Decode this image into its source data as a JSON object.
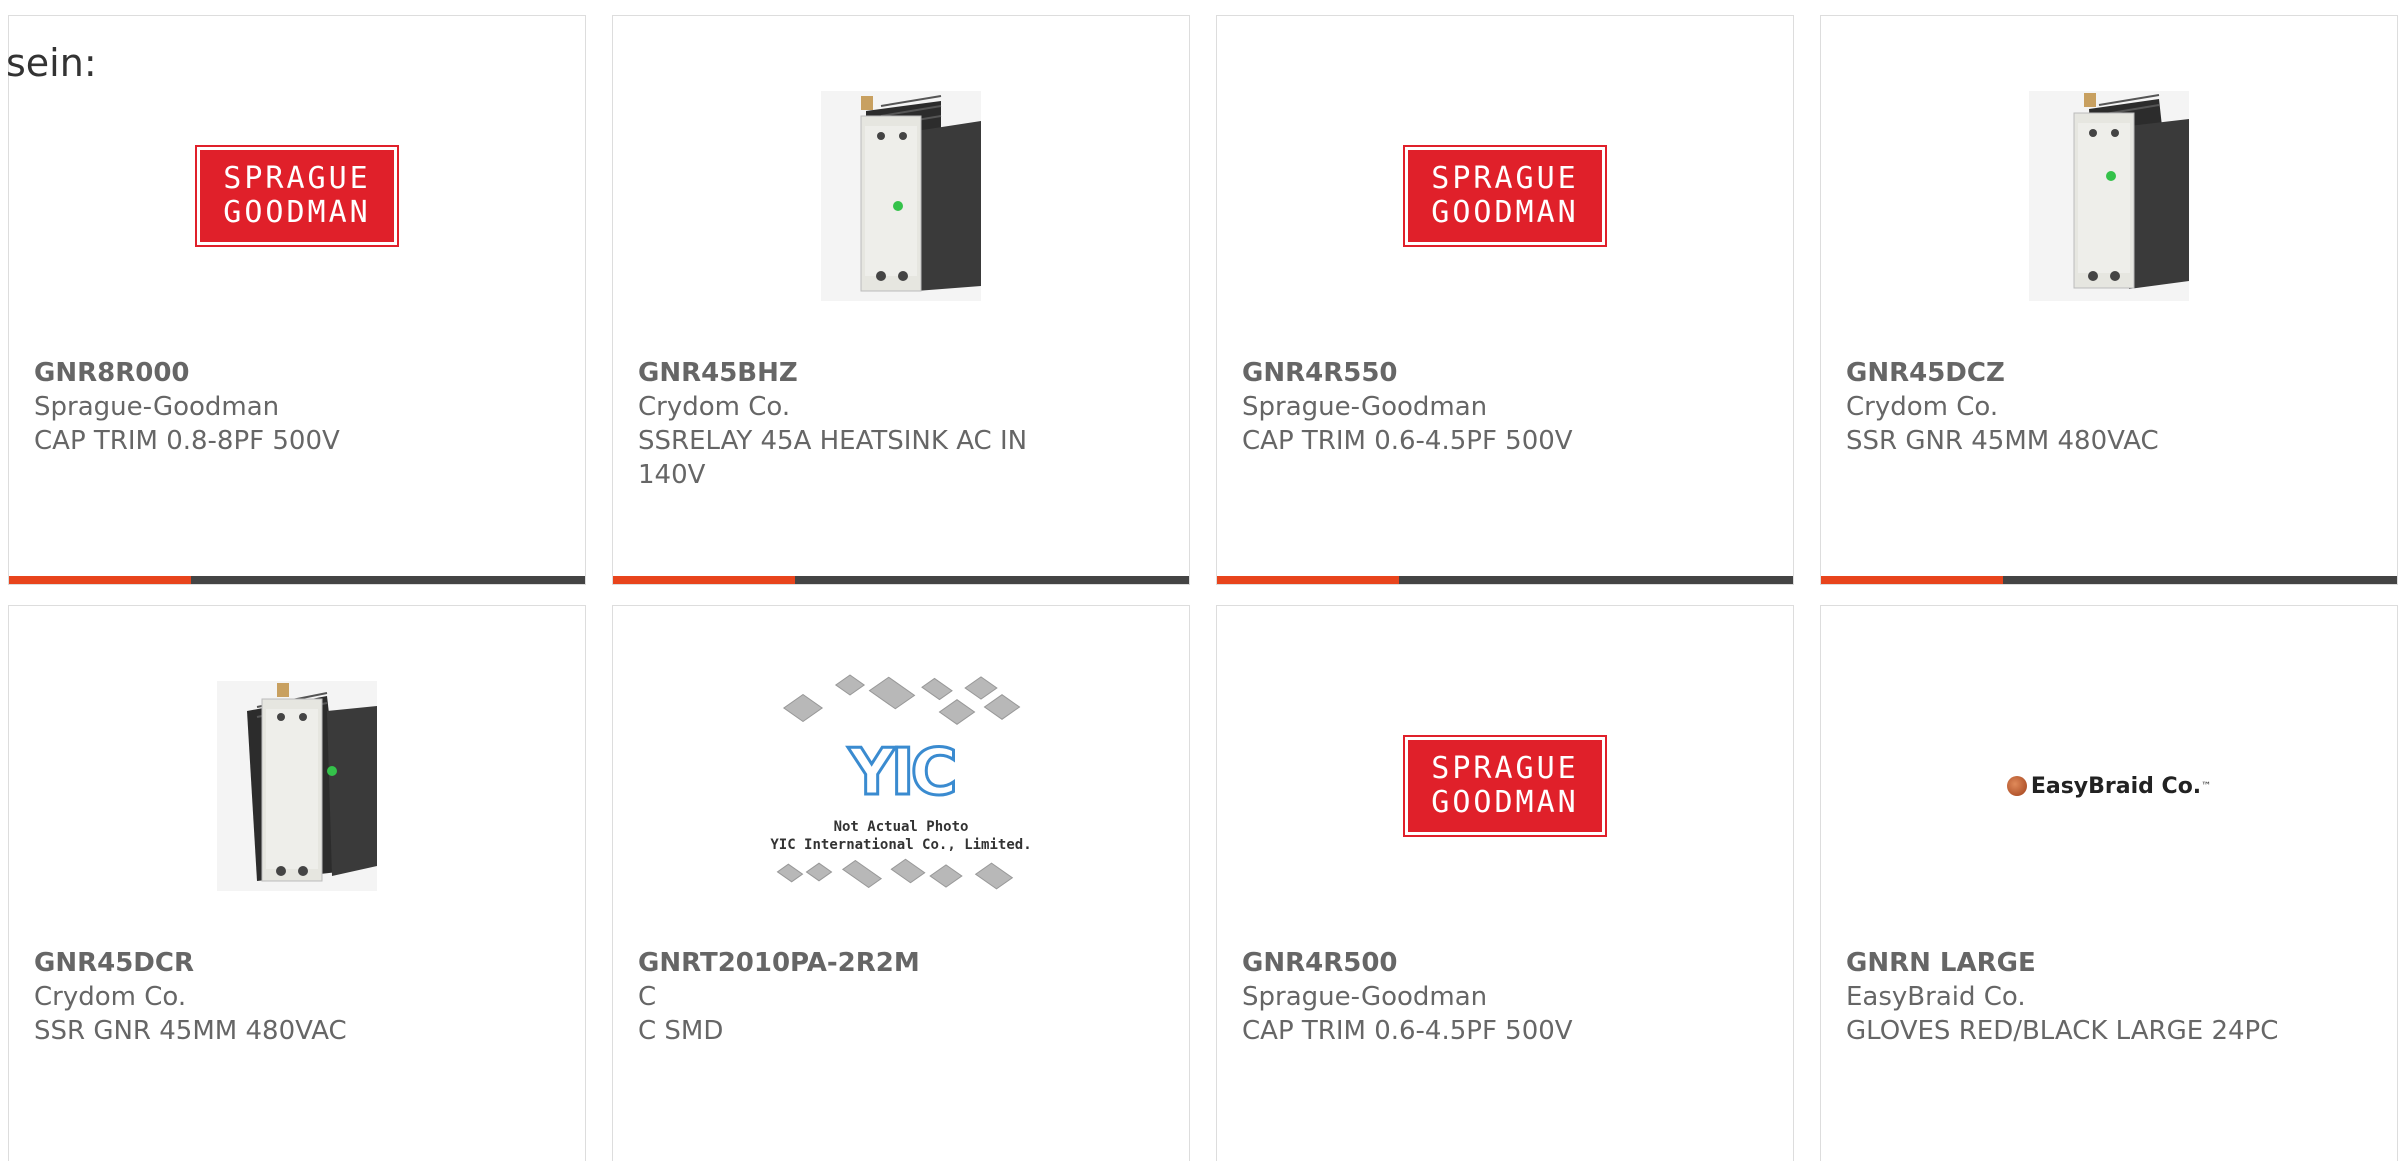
{
  "intro_text": "sein:",
  "colors": {
    "accent": "#e8441c",
    "bar_dark": "#444444",
    "sprague_red": "#e0202a",
    "text": "#666666"
  },
  "products": [
    {
      "part": "GNR8R000",
      "manufacturer": "Sprague-Goodman",
      "description": "CAP TRIM 0.8-8PF 500V",
      "image": "sprague-goodman-logo",
      "logo_lines": [
        "SPRAGUE",
        "GOODMAN"
      ]
    },
    {
      "part": "GNR45BHZ",
      "manufacturer": "Crydom Co.",
      "description": "SSRELAY 45A HEATSINK AC IN 140V",
      "image": "solid-state-relay-photo"
    },
    {
      "part": "GNR4R550",
      "manufacturer": "Sprague-Goodman",
      "description": "CAP TRIM 0.6-4.5PF 500V",
      "image": "sprague-goodman-logo",
      "logo_lines": [
        "SPRAGUE",
        "GOODMAN"
      ]
    },
    {
      "part": "GNR45DCZ",
      "manufacturer": "Crydom Co.",
      "description": "SSR GNR 45MM 480VAC",
      "image": "solid-state-relay-photo"
    },
    {
      "part": "GNR45DCR",
      "manufacturer": "Crydom Co.",
      "description": "SSR GNR 45MM 480VAC",
      "image": "solid-state-relay-photo"
    },
    {
      "part": "GNRT2010PA-2R2M",
      "manufacturer": "C",
      "description": "C SMD",
      "image": "yic-placeholder",
      "placeholder_brand": "YIC",
      "placeholder_caption": [
        "Not Actual Photo",
        "YIC International Co., Limited."
      ]
    },
    {
      "part": "GNR4R500",
      "manufacturer": "Sprague-Goodman",
      "description": "CAP TRIM 0.6-4.5PF 500V",
      "image": "sprague-goodman-logo",
      "logo_lines": [
        "SPRAGUE",
        "GOODMAN"
      ]
    },
    {
      "part": "GNRN LARGE",
      "manufacturer": "EasyBraid Co.",
      "description": "GLOVES RED/BLACK LARGE 24PC",
      "image": "easybraid-logo",
      "logo_text": "EasyBraid Co."
    }
  ]
}
